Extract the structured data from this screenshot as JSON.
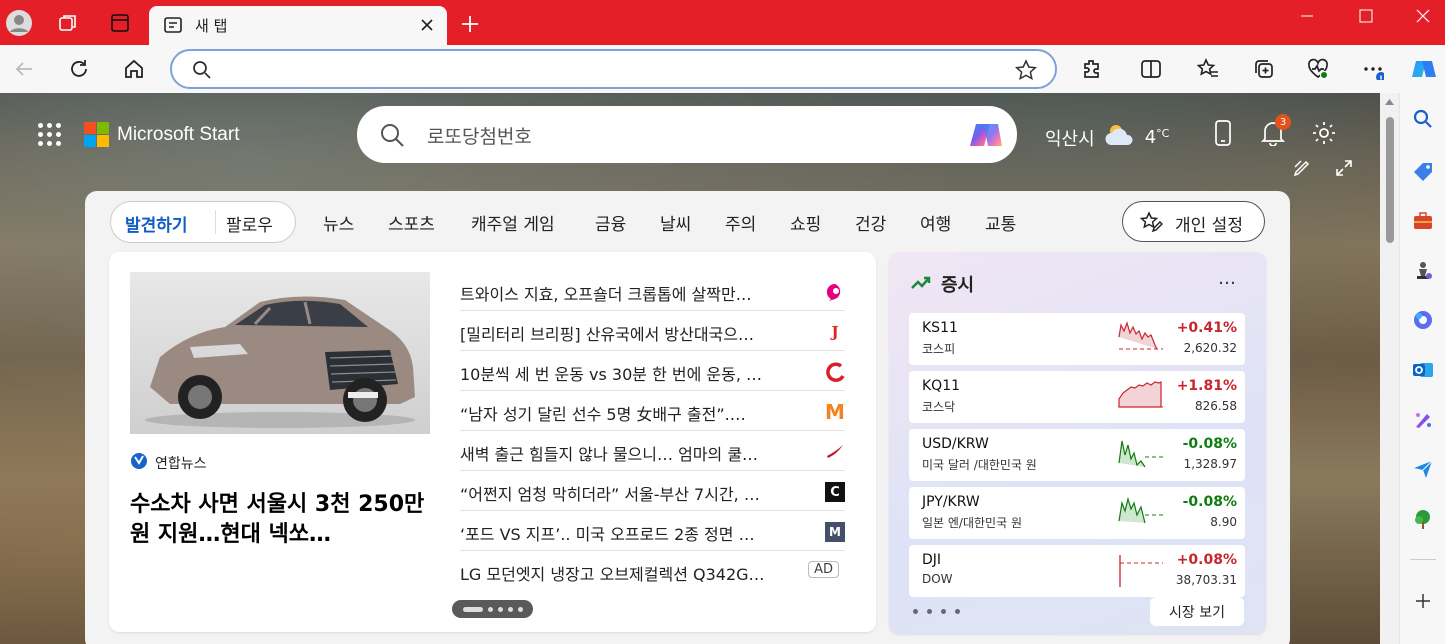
{
  "browser": {
    "tab": {
      "title": "새 탭"
    },
    "address": {
      "value": "",
      "placeholder": ""
    }
  },
  "header": {
    "brand": "Microsoft Start",
    "search_value": "로또당첨번호",
    "weather": {
      "city": "익산시",
      "temp": "4",
      "unit": "°C"
    },
    "notification_count": "3"
  },
  "nav": {
    "discover": "발견하기",
    "following": "팔로우",
    "categories": [
      "뉴스",
      "스포츠",
      "캐주얼 게임",
      "금융",
      "날씨",
      "주의",
      "쇼핑",
      "건강",
      "여행",
      "교통"
    ],
    "personalize": "개인 설정"
  },
  "hero": {
    "source": "연합뉴스",
    "title": "수소차 사면 서울시 3천 250만원 지원…현대 넥쏘…"
  },
  "news": [
    {
      "title": "트와이스 지효, 오프숄더 크롭톱에 살짝만…",
      "icon": "pink-bubble-icon",
      "color": "#e6007e"
    },
    {
      "title": "[밀리터리 브리핑] 산유국에서 방산대국으…",
      "icon": "j-logo-icon",
      "color": "#e2221c",
      "glyph": "J"
    },
    {
      "title": "10분씩 세 번 운동 vs 30분 한 번에 운동, …",
      "icon": "c-swoosh-icon",
      "color": "#d3222a"
    },
    {
      "title": "“남자 성기 달린 선수 5명 女배구 출전”.…",
      "icon": "m-logo-icon",
      "color": "#f58220",
      "glyph": "M"
    },
    {
      "title": "새벽 출근 힘들지 않나 물으니… 엄마의 쿨…",
      "icon": "swoosh-icon",
      "color": "#c8102e"
    },
    {
      "title": "“어쩐지 엄청 막히더라” 서울-부산 7시간, …",
      "icon": "c-box-icon",
      "color": "#111111",
      "glyph": "C"
    },
    {
      "title": "‘포드 VS 지프’.. 미국 오프로드 2종 정면 …",
      "icon": "m-box-icon",
      "color": "#44506a",
      "glyph": "M"
    },
    {
      "title": "LG 모던엣지 냉장고 오브제컬렉션 Q342G…",
      "ad": "AD"
    }
  ],
  "stocks": {
    "title": "증시",
    "more": "…",
    "rows": [
      {
        "symbol": "KS11",
        "name": "코스피",
        "change": "+0.41%",
        "value": "2,620.32",
        "dir": "up"
      },
      {
        "symbol": "KQ11",
        "name": "코스닥",
        "change": "+1.81%",
        "value": "826.58",
        "dir": "up"
      },
      {
        "symbol": "USD/KRW",
        "name": "미국 달러 /대한민국 원",
        "change": "-0.08%",
        "value": "1,328.97",
        "dir": "down"
      },
      {
        "symbol": "JPY/KRW",
        "name": "일본 엔/대한민국 원",
        "change": "-0.08%",
        "value": "8.90",
        "dir": "down"
      },
      {
        "symbol": "DJI",
        "name": "DOW",
        "change": "+0.08%",
        "value": "38,703.31",
        "dir": "up"
      }
    ],
    "button": "시장 보기"
  },
  "colors": {
    "titlebar": "#e41f27",
    "accent": "#0f5cc4",
    "up": "#c7262e",
    "down": "#107c10"
  }
}
